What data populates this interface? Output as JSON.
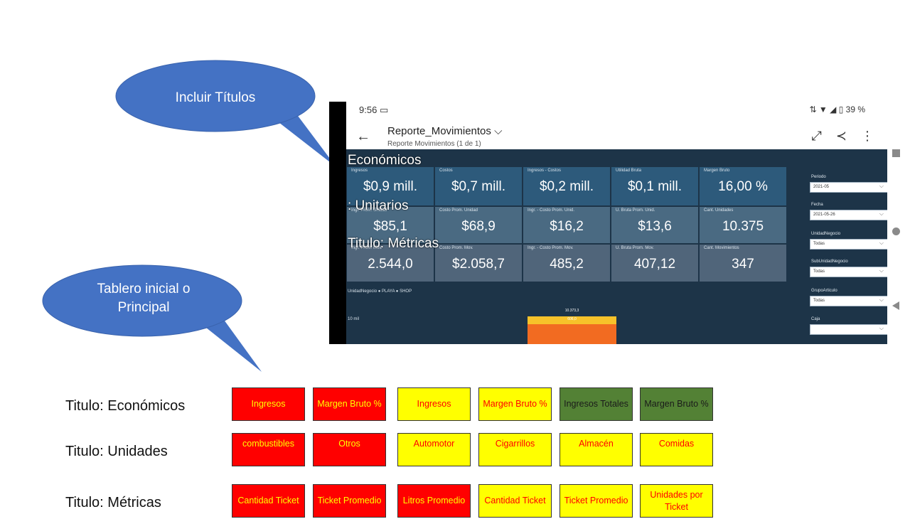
{
  "callouts": {
    "top": "Incluir Títulos",
    "bottom": "Tablero inicial o Principal"
  },
  "phone": {
    "time": "9:56",
    "battery": "39 %",
    "report_title": "Reporte_Movimientos",
    "report_subtitle": "Reporte Movimientos (1 de 1)"
  },
  "overlay_titles": {
    "economicos": "Económicos",
    "unitarios": ": Unitarios",
    "metricas": "Titulo: Métricas"
  },
  "kpis": {
    "row1": [
      {
        "label": "Ingresos",
        "value": "$0,9 mill."
      },
      {
        "label": "Costos",
        "value": "$0,7 mill."
      },
      {
        "label": "Ingresos - Costos",
        "value": "$0,2 mill."
      },
      {
        "label": "Utilidad Bruta",
        "value": "$0,1 mill."
      },
      {
        "label": "Margen Bruto",
        "value": "16,00 %"
      }
    ],
    "row2": [
      {
        "label": "Ingr. Prom. Unidad",
        "value": "$85,1"
      },
      {
        "label": "Costo Prom. Unidad",
        "value": "$68,9"
      },
      {
        "label": "Ingr. - Costo Prom. Unid.",
        "value": "$16,2"
      },
      {
        "label": "U. Bruta Prom. Unid.",
        "value": "$13,6"
      },
      {
        "label": "Cant. Unidades",
        "value": "10.375"
      }
    ],
    "row3": [
      {
        "label": "Ingr. Prom. Mov.",
        "value": "2.544,0"
      },
      {
        "label": "Costo Prom. Mov.",
        "value": "$2.058,7"
      },
      {
        "label": "Ingr. - Costo Prom. Mov.",
        "value": "485,2"
      },
      {
        "label": "U. Bruta Prom. Mov.",
        "value": "407,12"
      },
      {
        "label": "Cant. Movimientos",
        "value": "347"
      }
    ]
  },
  "filters": [
    {
      "label": "Periodo",
      "value": "2021-05"
    },
    {
      "label": "Fecha",
      "value": "2021-05-26"
    },
    {
      "label": "UnidadNegocio",
      "value": "Todas"
    },
    {
      "label": "SubUnidadNegocio",
      "value": "Todas"
    },
    {
      "label": "GrupoArticulo",
      "value": "Todas"
    },
    {
      "label": "Caja",
      "value": ""
    }
  ],
  "chart": {
    "legend": "UnidadNegocio ● PLAYA ● SHOP",
    "axis_label": "10 mil",
    "total_label": "10.373,3",
    "segment_label": "606,0",
    "colors": {
      "playa": "#f26b21",
      "shop": "#f7c22a"
    }
  },
  "grid": {
    "rows": [
      {
        "title": "Titulo: Económicos",
        "boxes": [
          {
            "text": "Ingresos",
            "color": "red"
          },
          {
            "text": "Margen Bruto %",
            "color": "red"
          },
          {
            "text": "Ingresos",
            "color": "yellow"
          },
          {
            "text": "Margen Bruto %",
            "color": "yellow"
          },
          {
            "text": "Ingresos Totales",
            "color": "green"
          },
          {
            "text": "Margen Bruto %",
            "color": "green"
          }
        ]
      },
      {
        "title": "Titulo: Unidades",
        "boxes": [
          {
            "text": "combustibles",
            "color": "red"
          },
          {
            "text": "Otros",
            "color": "red"
          },
          {
            "text": "Automotor",
            "color": "yellow"
          },
          {
            "text": "Cigarrillos",
            "color": "yellow"
          },
          {
            "text": "Almacén",
            "color": "yellow"
          },
          {
            "text": "Comidas",
            "color": "yellow"
          }
        ]
      },
      {
        "title": "Titulo: Métricas",
        "boxes": [
          {
            "text": "Cantidad Ticket",
            "color": "red"
          },
          {
            "text": "Ticket Promedio",
            "color": "red"
          },
          {
            "text": "Litros Promedio",
            "color": "red"
          },
          {
            "text": "Cantidad Ticket",
            "color": "yellow"
          },
          {
            "text": "Ticket Promedio",
            "color": "yellow"
          },
          {
            "text": "Unidades por Ticket",
            "color": "yellow"
          }
        ]
      }
    ]
  }
}
